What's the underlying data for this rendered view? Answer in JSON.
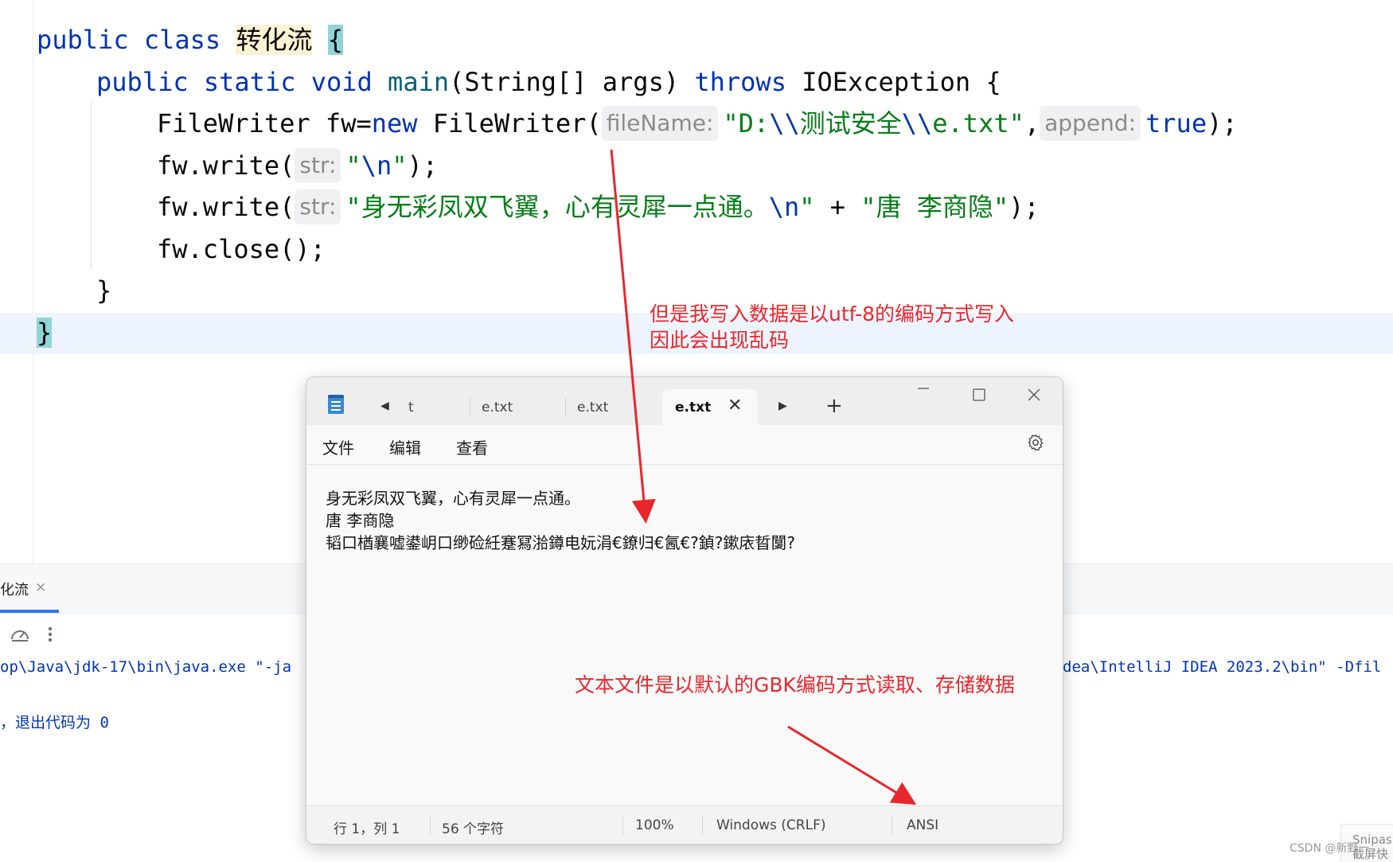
{
  "editor": {
    "line1": {
      "kw": "public class ",
      "classname": "转化流",
      "brace": "{"
    },
    "line2": {
      "kw1": "public static void ",
      "method": "main",
      "params": "(String[] args) ",
      "kw2": "throws",
      "rest": " IOException {"
    },
    "line3": {
      "pre": "FileWriter fw=",
      "kw": "new",
      "ctor": " FileWriter(",
      "hint1": "fileName:",
      "str_a": "\"D:",
      "esc1": "\\\\",
      "str_b": "测试安全",
      "esc2": "\\\\",
      "str_c": "e.txt\"",
      "comma": ",",
      "hint2": "append:",
      "kwtrue": "true",
      "end": ");"
    },
    "line4": {
      "pre": "fw.write(",
      "hint": "str:",
      "q1": "\"",
      "esc": "\\n",
      "q2": "\"",
      "end": ");"
    },
    "line5": {
      "pre": "fw.write(",
      "hint": "str:",
      "str_a": "\"身无彩凤双飞翼，心有灵犀一点通。",
      "esc": "\\n",
      "str_b": "\"",
      "plus": " + ",
      "str_c": "\"唐 李商隐\"",
      "end": ");"
    },
    "line6": "fw.close();",
    "line7": "}",
    "line8": "}"
  },
  "run_panel": {
    "tab_label": "化流",
    "tab_close": "×",
    "console_line1_left": "op\\Java\\jdk-17\\bin\\java.exe \"-ja",
    "console_line1_right": "dea\\IntelliJ IDEA 2023.2\\bin\" -Dfil",
    "console_line2": "，退出代码为 0"
  },
  "notepad": {
    "tabs": [
      "t",
      "e.txt",
      "e.txt"
    ],
    "active_tab": "e.txt",
    "tab_close": "✕",
    "new_tab": "+",
    "menu": [
      "文件",
      "编辑",
      "查看"
    ],
    "content": "身无彩凤双飞翼，心有灵犀一点通。\n唐 李商隐\n韬口楢襄嘘鍙岄口缈硷紝蹇冩湁鐏电妧涓€鐐归€氥€?鍞?鏉庡晢闅?",
    "status": {
      "position": "行 1，列 1",
      "chars": "56 个字符",
      "zoom": "100%",
      "line_ending": "Windows (CRLF)",
      "encoding": "ANSI"
    }
  },
  "annotations": {
    "top": "但是我写入数据是以utf-8的编码方式写入\n因此会出现乱码",
    "bottom": "文本文件是以默认的GBK编码方式读取、存储数据"
  },
  "watermark": "CSDN @新野一",
  "snipaste": "Snipas\n截屏快"
}
